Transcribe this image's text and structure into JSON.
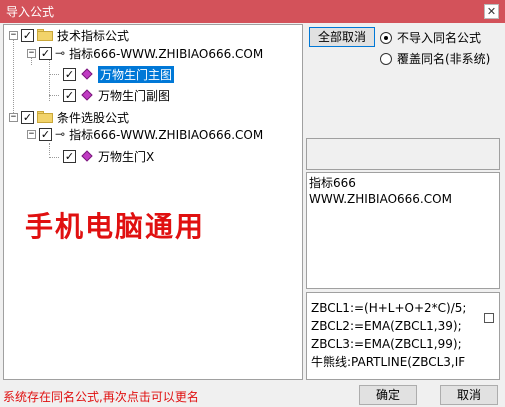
{
  "window": {
    "title": "导入公式",
    "close_glyph": "✕"
  },
  "tree": {
    "items": [
      {
        "label": "技术指标公式",
        "type": "folder",
        "expander": "−",
        "checked": "✓"
      },
      {
        "label": "指标666-WWW.ZHIBIAO666.COM",
        "type": "key",
        "expander": "−",
        "checked": "✓"
      },
      {
        "label": "万物生门主图",
        "type": "formula",
        "checked": "✓",
        "selected": true
      },
      {
        "label": "万物生门副图",
        "type": "formula",
        "checked": "✓"
      },
      {
        "label": "条件选股公式",
        "type": "folder",
        "expander": "−",
        "checked": "✓"
      },
      {
        "label": "指标666-WWW.ZHIBIAO666.COM",
        "type": "key",
        "expander": "−",
        "checked": "✓"
      },
      {
        "label": "万物生门X",
        "type": "formula",
        "checked": "✓"
      }
    ]
  },
  "overlay_text": "手机电脑通用",
  "buttons": {
    "cancel_all": "全部取消",
    "ok": "确定",
    "cancel": "取消"
  },
  "options": {
    "no_import_same_name": "不导入同名公式",
    "overwrite_same_name": "覆盖同名(非系统)"
  },
  "description": {
    "line1": "指标666",
    "line2": "WWW.ZHIBIAO666.COM"
  },
  "code_lines": [
    "ZBCL1:=(H+L+O+2*C)/5;",
    "ZBCL2:=EMA(ZBCL1,39);",
    "ZBCL3:=EMA(ZBCL1,99);",
    "牛熊线:PARTLINE(ZBCL3,IF"
  ],
  "status_text": "系统存在同名公式,再次点击可以更名",
  "colors": {
    "titlebar": "#d3525a",
    "selection": "#0078d7",
    "overlay_red": "#e01010",
    "diamond": "#c03bc3"
  }
}
